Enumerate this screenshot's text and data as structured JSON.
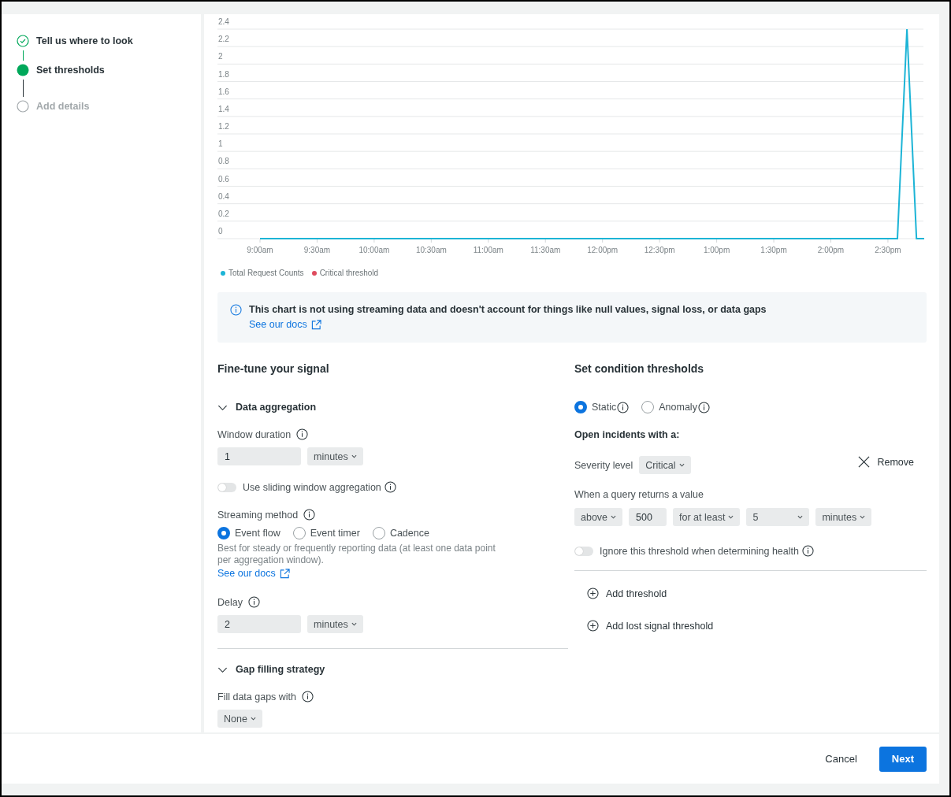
{
  "steps": [
    {
      "label": "Tell us where to look",
      "kind": "done"
    },
    {
      "label": "Set thresholds",
      "kind": "current"
    },
    {
      "label": "Add details",
      "kind": "pending"
    }
  ],
  "chart": {
    "chart_data": {
      "type": "line",
      "categories": [
        "9:00am",
        null,
        null,
        null,
        null,
        null,
        "9:30am",
        null,
        null,
        null,
        null,
        null,
        "10:00am",
        null,
        null,
        null,
        null,
        null,
        "10:30am",
        null,
        null,
        null,
        null,
        null,
        "11:00am",
        null,
        null,
        null,
        null,
        null,
        "11:30am",
        null,
        null,
        null,
        null,
        null,
        "12:00pm",
        null,
        null,
        null,
        null,
        null,
        "12:30pm",
        null,
        null,
        null,
        null,
        null,
        "1:00pm",
        null,
        null,
        null,
        null,
        null,
        "1:30pm",
        null,
        null,
        null,
        null,
        null,
        "2:00pm",
        null,
        null,
        null,
        null,
        null,
        "2:30pm",
        null,
        null,
        null,
        null
      ],
      "yticks": [
        0,
        0.2,
        0.4,
        0.6,
        0.8,
        1,
        1.2,
        1.4,
        1.6,
        1.8,
        2,
        2.2,
        2.4
      ],
      "grid": true,
      "ylim": [
        0,
        2.4
      ],
      "series": [
        {
          "name": "Total Request Counts",
          "color": "#1cb4d6",
          "values": [
            0,
            0,
            0,
            0,
            0,
            0,
            0,
            0,
            0,
            0,
            0,
            0,
            0,
            0,
            0,
            0,
            0,
            0,
            0,
            0,
            0,
            0,
            0,
            0,
            0,
            0,
            0,
            0,
            0,
            0,
            0,
            0,
            0,
            0,
            0,
            0,
            0,
            0,
            0,
            0,
            0,
            0,
            0,
            0,
            0,
            0,
            0,
            0,
            0,
            0,
            0,
            0,
            0,
            0,
            0,
            0,
            0,
            0,
            0,
            0,
            0,
            0,
            0,
            0,
            0,
            0,
            0,
            0,
            2.4,
            0,
            0
          ]
        },
        {
          "name": "Critical threshold",
          "color": "#df4b5e",
          "values": [
            null,
            null,
            null,
            null,
            null,
            null,
            null,
            null,
            null,
            null,
            null,
            null,
            null,
            null,
            null,
            null,
            null,
            null,
            null,
            null,
            null,
            null,
            null,
            null,
            null,
            null,
            null,
            null,
            null,
            null,
            null,
            null,
            null,
            null,
            null,
            null,
            null,
            null,
            null,
            null,
            null,
            null,
            null,
            null,
            null,
            null,
            null,
            null,
            null,
            null,
            null,
            null,
            null,
            null,
            null,
            null,
            null,
            null,
            null,
            null,
            null,
            null,
            null,
            null,
            null,
            null,
            null,
            null,
            null,
            null,
            null
          ]
        }
      ]
    }
  },
  "notice": {
    "text": "This chart is not using streaming data and doesn't account for things like null values, signal loss, or data gaps",
    "link": "See our docs"
  },
  "fine_tune": {
    "title": "Fine-tune your signal",
    "data_aggregation": {
      "title": "Data aggregation",
      "expanded": true,
      "window_duration": {
        "label": "Window duration",
        "value": "1",
        "unit": "minutes"
      },
      "sliding_window": {
        "label": "Use sliding window aggregation",
        "on": false
      },
      "streaming_method": {
        "label": "Streaming method",
        "options": [
          {
            "label": "Event flow",
            "selected": true
          },
          {
            "label": "Event timer",
            "selected": false
          },
          {
            "label": "Cadence",
            "selected": false
          }
        ],
        "help": "Best for steady or frequently reporting data (at least one data point per aggregation window).",
        "link": "See our docs"
      },
      "delay": {
        "label": "Delay",
        "value": "2",
        "unit": "minutes"
      }
    },
    "gap_filling": {
      "title": "Gap filling strategy",
      "expanded": true,
      "label": "Fill data gaps with",
      "value": "None"
    }
  },
  "thresholds": {
    "title": "Set condition thresholds",
    "types": [
      {
        "label": "Static",
        "selected": true
      },
      {
        "label": "Anomaly",
        "selected": false
      }
    ],
    "open_label": "Open incidents with a:",
    "severity_label": "Severity level",
    "severity": "Critical",
    "remove": "Remove",
    "query_label": "When a query returns a value",
    "operator": "above",
    "value": "500",
    "occurrence": "for at least",
    "duration": "5",
    "unit": "minutes",
    "ignore": {
      "label": "Ignore this threshold when determining health",
      "on": false
    },
    "actions": [
      "Add threshold",
      "Add lost signal threshold"
    ]
  },
  "footer": {
    "cancel": "Cancel",
    "next": "Next"
  }
}
